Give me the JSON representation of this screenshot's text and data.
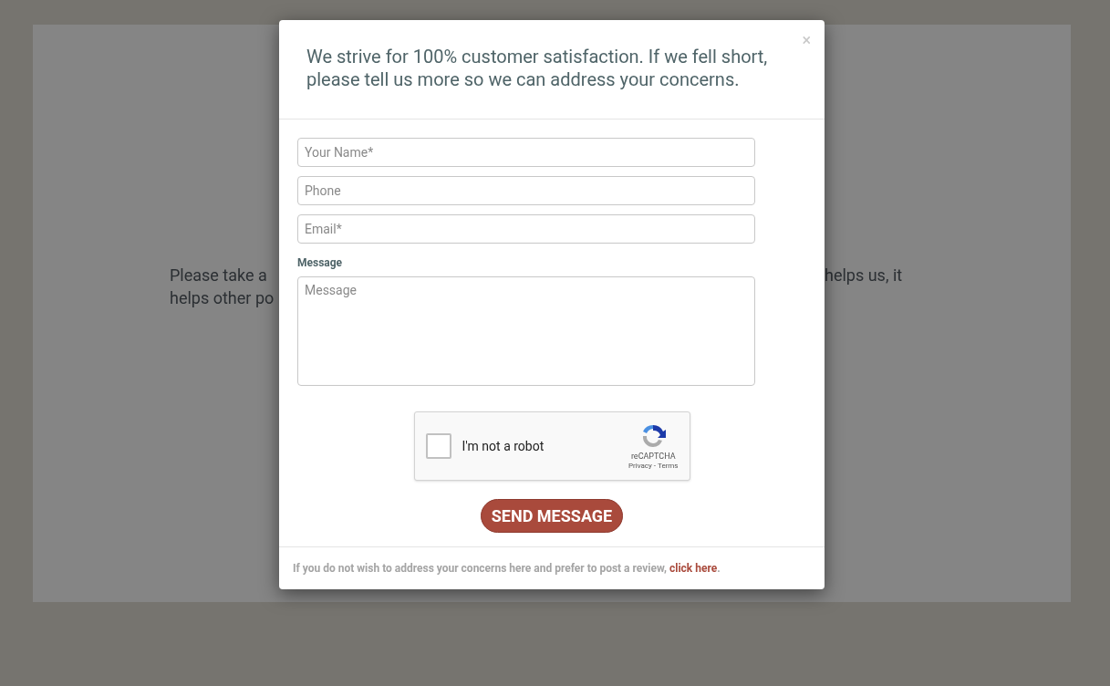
{
  "background": {
    "left_lines": [
      "Please take a",
      "helps other po"
    ],
    "right_lines": [
      "helps us, it"
    ]
  },
  "modal": {
    "close": "×",
    "heading": "We strive for 100% customer satisfaction. If we fell short, please tell us more so we can address your concerns.",
    "fields": [
      {
        "placeholder": "Your Name*"
      },
      {
        "placeholder": "Phone"
      },
      {
        "placeholder": "Email*"
      }
    ],
    "message": {
      "label": "Message",
      "placeholder": "Message"
    },
    "captcha": {
      "label": "I'm not a robot",
      "checked": false,
      "brand": "reCAPTCHA",
      "privacy": "Privacy",
      "separator": "-",
      "terms": "Terms"
    },
    "submit": "SEND MESSAGE",
    "footer": {
      "text": "If you do not wish to address your concerns here and prefer to post a review,",
      "link": "click here",
      "end": "."
    }
  }
}
